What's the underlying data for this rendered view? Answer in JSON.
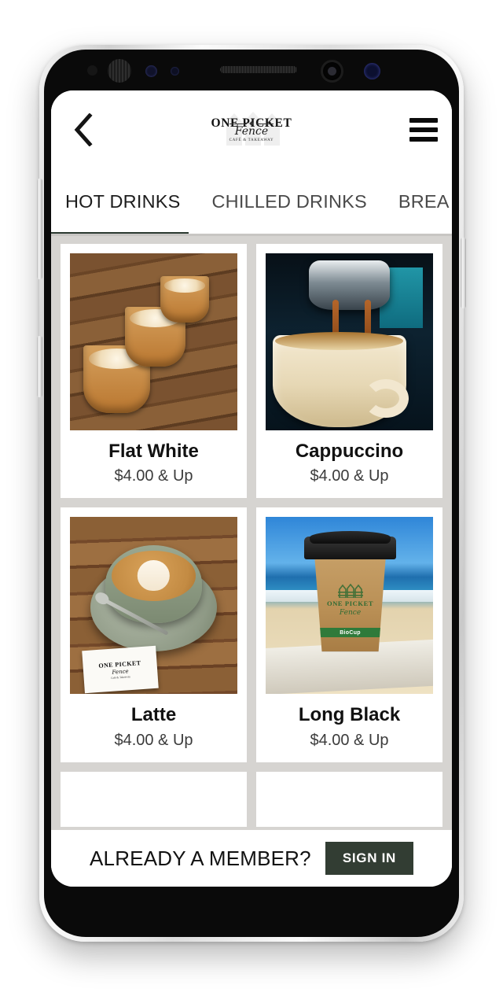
{
  "app": {
    "brand": {
      "logo_top": "ONE PICKET",
      "logo_script": "Fence",
      "logo_sub": "CAFÉ & TAKEAWAY"
    },
    "nav": {
      "back_icon": "chevron-left-icon",
      "menu_icon": "hamburger-menu-icon"
    },
    "tabs": [
      {
        "label": "HOT DRINKS",
        "active": true
      },
      {
        "label": "CHILLED DRINKS",
        "active": false
      },
      {
        "label": "BREA",
        "active": false
      }
    ],
    "products": [
      {
        "name": "Flat White",
        "price": "$4.00 & Up",
        "image": "three-glass-coffees-on-wooden-table"
      },
      {
        "name": "Cappuccino",
        "price": "$4.00 & Up",
        "image": "espresso-pouring-into-cup"
      },
      {
        "name": "Latte",
        "price": "$4.00 & Up",
        "image": "latte-art-in-green-cup-with-business-card"
      },
      {
        "name": "Long Black",
        "price": "$4.00 & Up",
        "image": "takeaway-cup-at-beach"
      }
    ],
    "member_bar": {
      "prompt": "ALREADY A MEMBER?",
      "sign_in_label": "SIGN IN"
    },
    "photo_text": {
      "card_line1": "ONE PICKET",
      "card_line2": "Fence",
      "card_line3": "Café & Takeaway",
      "cup_line1": "ONE PICKET",
      "cup_line2": "Fence",
      "cup_band": "BioCup"
    },
    "colors": {
      "accent_green": "#2c3a31",
      "button_green": "#323d33",
      "page_background": "#d6d4d1",
      "card_background": "#ffffff"
    }
  }
}
